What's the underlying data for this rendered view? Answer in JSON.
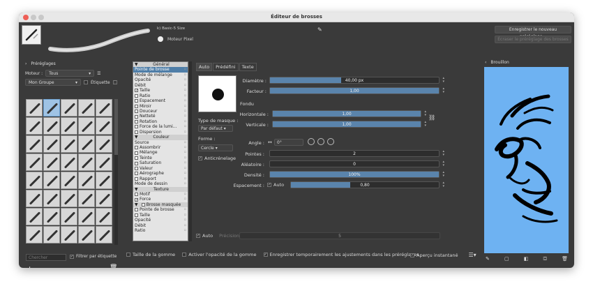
{
  "window": {
    "title": "Éditeur de brosses"
  },
  "top": {
    "brush_name": "k) Basic-5 Size",
    "engine": "Moteur Pixel",
    "save_new": "Enregistrer le nouveau préréglage...",
    "overwrite": "Écraser le préréglage des brosses"
  },
  "presets": {
    "title": "Préréglages",
    "engine_label": "Moteur :",
    "engine_value": "Tous",
    "group_value": "Mon Groupe",
    "tag_label": "Étiquette",
    "search_placeholder": "Chercher",
    "filter_label": "Filtrer par étiquette"
  },
  "params": [
    {
      "t": "Général",
      "hdr": true
    },
    {
      "t": "Pointe de brosse",
      "sel": true
    },
    {
      "t": "Mode de mélange"
    },
    {
      "t": "Opacité"
    },
    {
      "t": "Débit"
    },
    {
      "t": "Taille",
      "chk": "on"
    },
    {
      "t": "Ratio",
      "chk": "off"
    },
    {
      "t": "Espacement",
      "chk": "off"
    },
    {
      "t": "Miroir",
      "chk": "off"
    },
    {
      "t": "Douceur",
      "chk": "off"
    },
    {
      "t": "Netteté",
      "chk": "off"
    },
    {
      "t": "Rotation",
      "chk": "off"
    },
    {
      "t": "Force de la lumi...",
      "chk": "off"
    },
    {
      "t": "Dispersion",
      "chk": "off"
    },
    {
      "t": "Couleur",
      "hdr": true
    },
    {
      "t": "Source"
    },
    {
      "t": "Assombrir",
      "chk": "off"
    },
    {
      "t": "Mélange",
      "chk": "off"
    },
    {
      "t": "Teinte",
      "chk": "off"
    },
    {
      "t": "Saturation",
      "chk": "off"
    },
    {
      "t": "Valeur",
      "chk": "off"
    },
    {
      "t": "Aérographe",
      "chk": "off"
    },
    {
      "t": "Rapport",
      "chk": "off"
    },
    {
      "t": "Mode de dessin"
    },
    {
      "t": "Texture",
      "hdr": true
    },
    {
      "t": "Motif",
      "chk": "off"
    },
    {
      "t": "Force",
      "chk": "on"
    },
    {
      "t": "Brosse masquée",
      "hdr": true,
      "chk": "off"
    },
    {
      "t": "Pointe de brosse",
      "chk": "off"
    },
    {
      "t": "Taille",
      "chk": "off"
    },
    {
      "t": "Opacité"
    },
    {
      "t": "Débit"
    },
    {
      "t": "Ratio"
    }
  ],
  "tabs": [
    "Auto",
    "Prédéfini",
    "Texte"
  ],
  "tip": {
    "mask_type_label": "Type de masque :",
    "mask_type_value": "Par défaut",
    "shape_label": "Forme :",
    "shape_value": "Cercle",
    "antialias": "Anticrénelage",
    "diameter_label": "Diamètre :",
    "diameter": "40,00 px",
    "diameter_frac": 0.42,
    "factor_label": "Facteur :",
    "factor": "1,00",
    "factor_frac": 1.0,
    "fade_label": "Fondu",
    "horizontal_label": "Horizontale :",
    "horizontal": "1,00",
    "horizontal_frac": 1.0,
    "vertical_label": "Verticale :",
    "vertical": "1,00",
    "vertical_frac": 1.0,
    "angle_label": "Angle :",
    "angle": "0°",
    "spikes_label": "Pointes :",
    "spikes": "2",
    "spikes_frac": 0.0,
    "randomness_label": "Aléatoire :",
    "randomness": "0",
    "randomness_frac": 0.0,
    "density_label": "Densité :",
    "density": "100%",
    "density_frac": 1.0,
    "spacing_label": "Espacement :",
    "spacing_auto": "Auto",
    "spacing": "0,80",
    "spacing_frac": 0.4,
    "precision_auto": "Auto",
    "precision_label": "Précision",
    "precision": "5"
  },
  "bottom": {
    "eraser_size": "Taille de la gomme",
    "eraser_opacity": "Activer l'opacité de la gomme",
    "temp_save": "Enregistrer temporairement les ajustements dans les préréglages",
    "instant_preview": "Aperçu instantané"
  },
  "scratchpad": {
    "title": "Brouillon"
  }
}
